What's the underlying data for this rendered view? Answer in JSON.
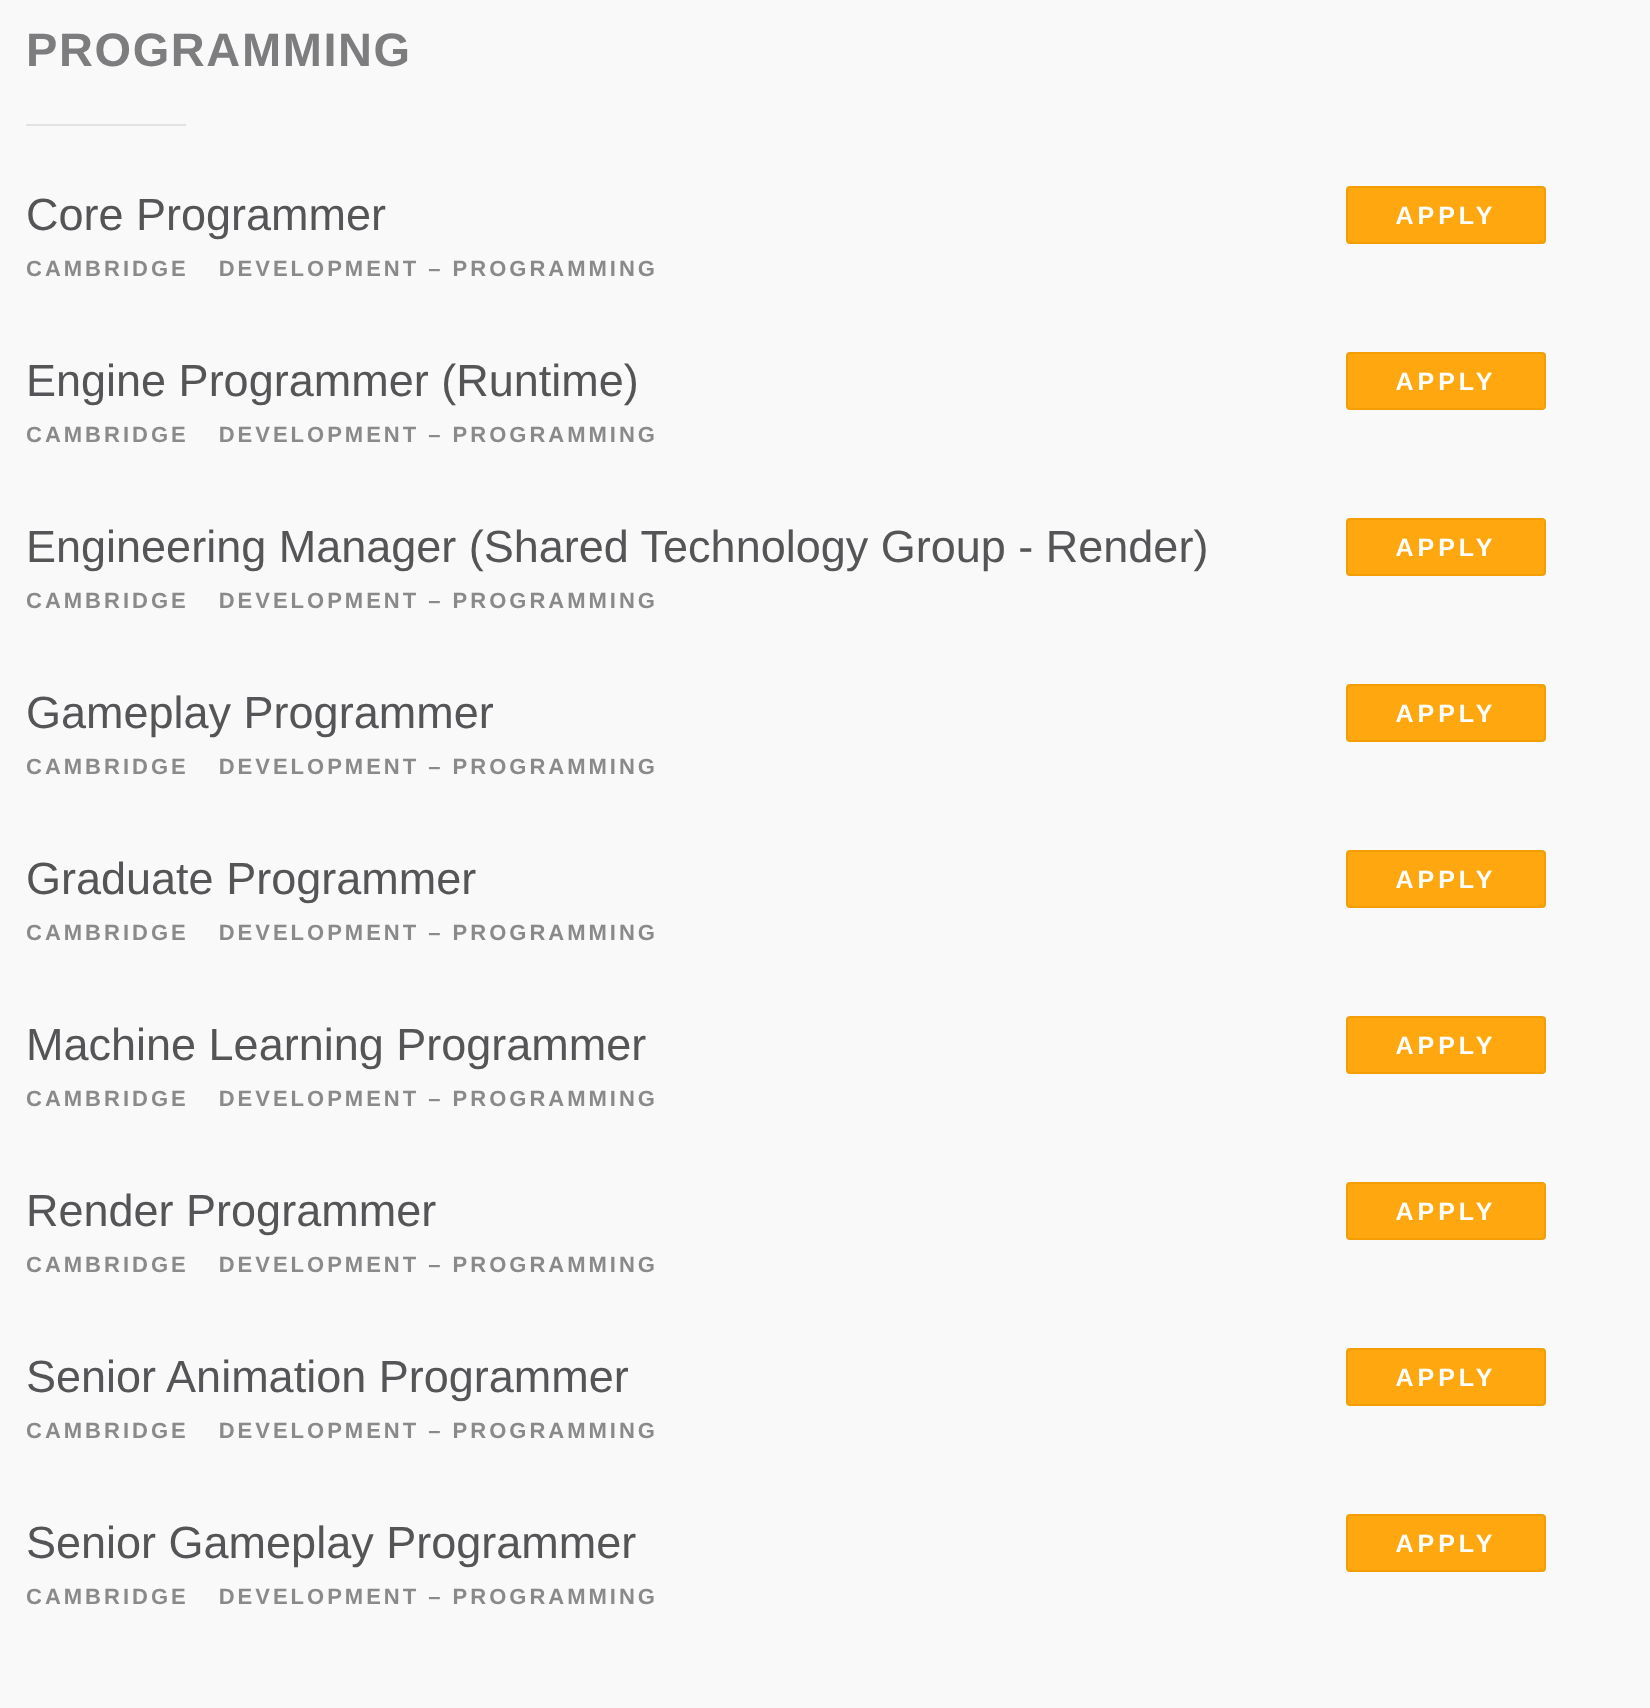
{
  "section": {
    "title": "PROGRAMMING"
  },
  "jobs": [
    {
      "title": "Core Programmer",
      "location": "CAMBRIDGE",
      "department": "DEVELOPMENT – PROGRAMMING",
      "button": "APPLY"
    },
    {
      "title": "Engine Programmer (Runtime)",
      "location": "CAMBRIDGE",
      "department": "DEVELOPMENT – PROGRAMMING",
      "button": "APPLY"
    },
    {
      "title": "Engineering Manager (Shared Technology Group - Render)",
      "location": "CAMBRIDGE",
      "department": "DEVELOPMENT – PROGRAMMING",
      "button": "APPLY"
    },
    {
      "title": "Gameplay Programmer",
      "location": "CAMBRIDGE",
      "department": "DEVELOPMENT – PROGRAMMING",
      "button": "APPLY"
    },
    {
      "title": "Graduate Programmer",
      "location": "CAMBRIDGE",
      "department": "DEVELOPMENT – PROGRAMMING",
      "button": "APPLY"
    },
    {
      "title": "Machine Learning Programmer",
      "location": "CAMBRIDGE",
      "department": "DEVELOPMENT – PROGRAMMING",
      "button": "APPLY"
    },
    {
      "title": "Render Programmer",
      "location": "CAMBRIDGE",
      "department": "DEVELOPMENT – PROGRAMMING",
      "button": "APPLY"
    },
    {
      "title": "Senior Animation Programmer",
      "location": "CAMBRIDGE",
      "department": "DEVELOPMENT – PROGRAMMING",
      "button": "APPLY"
    },
    {
      "title": "Senior Gameplay Programmer",
      "location": "CAMBRIDGE",
      "department": "DEVELOPMENT – PROGRAMMING",
      "button": "APPLY"
    }
  ]
}
